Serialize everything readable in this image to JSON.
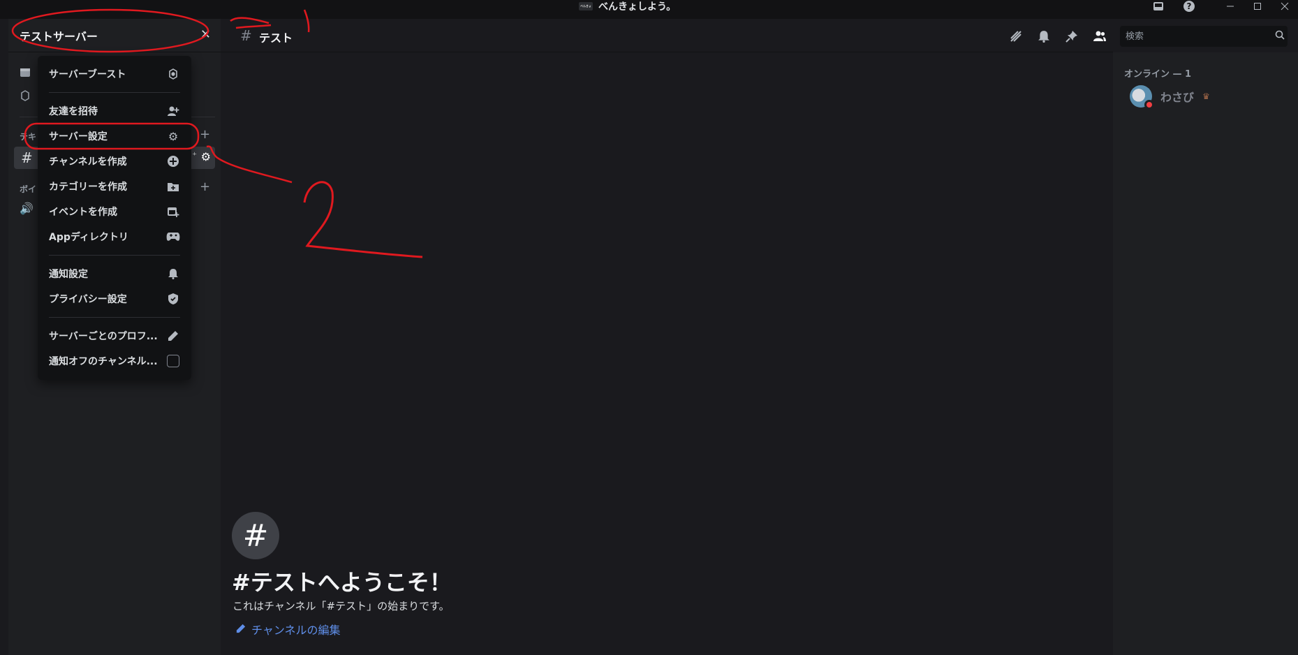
{
  "window": {
    "title": "べんきょしよう。",
    "logo_text": "べんきょ"
  },
  "server": {
    "name": "テストサーバー"
  },
  "sidebar": {
    "category_text_abbrev": "テキ",
    "category_voice_abbrev": "ボイ"
  },
  "menu": {
    "items": [
      {
        "label": "サーバーブースト",
        "icon": "boost-icon"
      },
      {
        "label": "友達を招待",
        "icon": "add-person-icon"
      },
      {
        "label": "サーバー設定",
        "icon": "gear-icon"
      },
      {
        "label": "チャンネルを作成",
        "icon": "plus-circle-icon"
      },
      {
        "label": "カテゴリーを作成",
        "icon": "folder-plus-icon"
      },
      {
        "label": "イベントを作成",
        "icon": "calendar-plus-icon"
      },
      {
        "label": "Appディレクトリ",
        "icon": "gamepad-icon"
      },
      {
        "label": "通知設定",
        "icon": "bell-icon"
      },
      {
        "label": "プライバシー設定",
        "icon": "shield-icon"
      },
      {
        "label": "サーバーごとのプロフ...",
        "icon": "pencil-icon"
      },
      {
        "label": "通知オフのチャンネル...",
        "icon": "checkbox-icon"
      }
    ]
  },
  "channel": {
    "name": "テスト",
    "search_placeholder": "検索",
    "welcome_title": "#テストへようこそ！",
    "welcome_subtitle": "これはチャンネル「#テスト」の始まりです。",
    "edit_link": "チャンネルの編集"
  },
  "members": {
    "header": "オンライン — 1",
    "list": [
      {
        "name": "わさび",
        "status": "dnd",
        "owner": true
      }
    ]
  },
  "annotations": {
    "step_number": "2"
  },
  "colors": {
    "accent_link": "#5f8ee8",
    "annotation_red": "#e0191f",
    "dnd_status": "#f23f43"
  }
}
